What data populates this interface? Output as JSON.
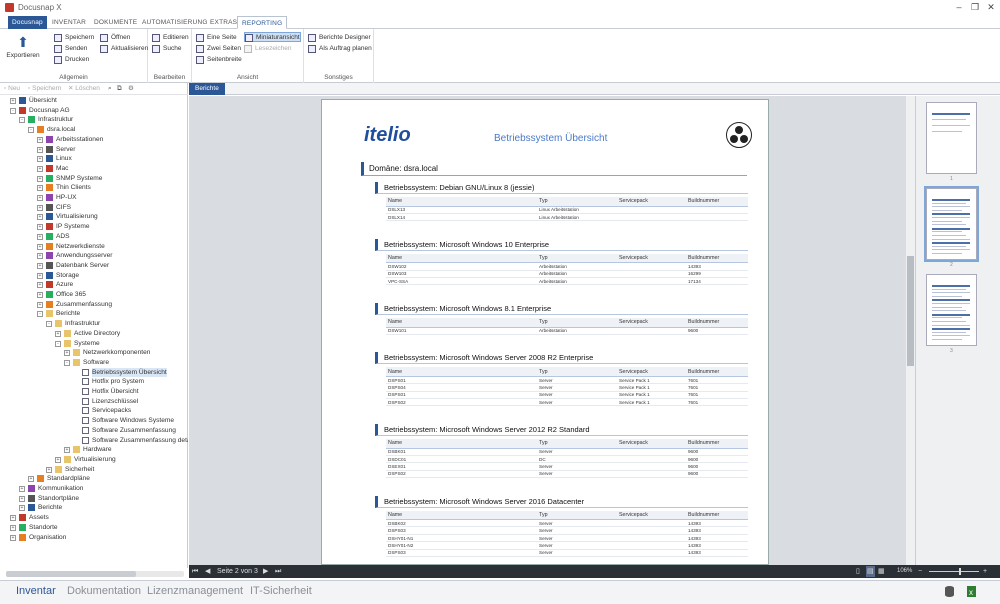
{
  "app": {
    "title": "Docusnap X"
  },
  "menu": {
    "file": "Docusnap",
    "tabs": [
      "INVENTAR",
      "DOKUMENTE",
      "AUTOMATISIERUNG",
      "EXTRAS",
      "REPORTING"
    ]
  },
  "ribbon": {
    "export_label": "Exportieren",
    "save": "Speichern",
    "open": "Öffnen",
    "send": "Senden",
    "refresh": "Aktualisieren",
    "print": "Drucken",
    "group_general": "Allgemein",
    "edit": "Editieren",
    "search": "Suche",
    "group_edit": "Bearbeiten",
    "one_page": "Eine Seite",
    "two_pages": "Zwei Seiten",
    "page_width": "Seitenbreite",
    "thumbnails": "Miniaturansicht",
    "bookmarks": "Lesezeichen",
    "group_view": "Ansicht",
    "report_designer": "Berichte Designer",
    "schedule": "Als Auftrag planen",
    "group_misc": "Sonstiges"
  },
  "left_toolbar": {
    "new": "Neu",
    "save": "Speichern",
    "delete": "Löschen"
  },
  "tree": [
    {
      "label": "Übersicht",
      "level": 0,
      "icon": "overview-icon",
      "expand": "+"
    },
    {
      "label": "Docusnap AG",
      "level": 0,
      "icon": "company-icon",
      "expand": "-"
    },
    {
      "label": "Infrastruktur",
      "level": 1,
      "icon": "infrastructure-icon",
      "expand": "-"
    },
    {
      "label": "dsra.local",
      "level": 2,
      "icon": "domain-icon",
      "expand": "-"
    },
    {
      "label": "Arbeitsstationen",
      "level": 3,
      "icon": "workstation-icon",
      "expand": "+"
    },
    {
      "label": "Server",
      "level": 3,
      "icon": "server-icon",
      "expand": "+"
    },
    {
      "label": "Linux",
      "level": 3,
      "icon": "linux-icon",
      "expand": "+"
    },
    {
      "label": "Mac",
      "level": 3,
      "icon": "mac-icon",
      "expand": "+"
    },
    {
      "label": "SNMP Systeme",
      "level": 3,
      "icon": "snmp-icon",
      "expand": "+"
    },
    {
      "label": "Thin Clients",
      "level": 3,
      "icon": "thin-client-icon",
      "expand": "+"
    },
    {
      "label": "HP-UX",
      "level": 3,
      "icon": "hpux-icon",
      "expand": "+"
    },
    {
      "label": "CIFS",
      "level": 3,
      "icon": "cifs-icon",
      "expand": "+"
    },
    {
      "label": "Virtualisierung",
      "level": 3,
      "icon": "virtualization-icon",
      "expand": "+"
    },
    {
      "label": "IP Systeme",
      "level": 3,
      "icon": "ip-system-icon",
      "expand": "+"
    },
    {
      "label": "ADS",
      "level": 3,
      "icon": "ads-icon",
      "expand": "+"
    },
    {
      "label": "Netzwerkdienste",
      "level": 3,
      "icon": "network-service-icon",
      "expand": "+"
    },
    {
      "label": "Anwendungsserver",
      "level": 3,
      "icon": "app-server-icon",
      "expand": "+"
    },
    {
      "label": "Datenbank Server",
      "level": 3,
      "icon": "database-icon",
      "expand": "+"
    },
    {
      "label": "Storage",
      "level": 3,
      "icon": "storage-icon",
      "expand": "+"
    },
    {
      "label": "Azure",
      "level": 3,
      "icon": "azure-icon",
      "expand": "+"
    },
    {
      "label": "Office 365",
      "level": 3,
      "icon": "office365-icon",
      "expand": "+"
    },
    {
      "label": "Zusammenfassung",
      "level": 3,
      "icon": "summary-icon",
      "expand": "+"
    },
    {
      "label": "Berichte",
      "level": 3,
      "icon": "reports-folder-icon",
      "expand": "-"
    },
    {
      "label": "Infrastruktur",
      "level": 4,
      "icon": "folder-icon",
      "expand": "-"
    },
    {
      "label": "Active Directory",
      "level": 5,
      "icon": "folder-icon",
      "expand": "+"
    },
    {
      "label": "Systeme",
      "level": 5,
      "icon": "folder-icon",
      "expand": "-"
    },
    {
      "label": "Netzwerkkomponenten",
      "level": 6,
      "icon": "folder-icon",
      "expand": "+"
    },
    {
      "label": "Software",
      "level": 6,
      "icon": "folder-icon",
      "expand": "-"
    },
    {
      "label": "Betriebssystem Übersicht",
      "level": 7,
      "icon": "report-icon",
      "expand": "",
      "selected": true
    },
    {
      "label": "Hotfix pro System",
      "level": 7,
      "icon": "report-icon",
      "expand": ""
    },
    {
      "label": "Hotfix Übersicht",
      "level": 7,
      "icon": "report-icon",
      "expand": ""
    },
    {
      "label": "Lizenzschlüssel",
      "level": 7,
      "icon": "report-icon",
      "expand": ""
    },
    {
      "label": "Servicepacks",
      "level": 7,
      "icon": "report-icon",
      "expand": ""
    },
    {
      "label": "Software Windows Systeme",
      "level": 7,
      "icon": "report-icon",
      "expand": ""
    },
    {
      "label": "Software Zusammenfassung",
      "level": 7,
      "icon": "report-icon",
      "expand": ""
    },
    {
      "label": "Software Zusammenfassung detaillie",
      "level": 7,
      "icon": "report-icon",
      "expand": ""
    },
    {
      "label": "Hardware",
      "level": 6,
      "icon": "folder-icon",
      "expand": "+"
    },
    {
      "label": "Virtualisierung",
      "level": 5,
      "icon": "folder-icon",
      "expand": "+"
    },
    {
      "label": "Sicherheit",
      "level": 4,
      "icon": "folder-icon",
      "expand": "+"
    },
    {
      "label": "Standardpläne",
      "level": 2,
      "icon": "plan-icon",
      "expand": "+"
    },
    {
      "label": "Kommunikation",
      "level": 1,
      "icon": "communication-icon",
      "expand": "+"
    },
    {
      "label": "Standortpläne",
      "level": 1,
      "icon": "location-plan-icon",
      "expand": "+"
    },
    {
      "label": "Berichte",
      "level": 1,
      "icon": "reports-icon",
      "expand": "+"
    },
    {
      "label": "Assets",
      "level": 0,
      "icon": "assets-icon",
      "expand": "+"
    },
    {
      "label": "Standorte",
      "level": 0,
      "icon": "location-icon",
      "expand": "+"
    },
    {
      "label": "Organisation",
      "level": 0,
      "icon": "organization-icon",
      "expand": "+"
    }
  ],
  "doc_tab": "Berichte",
  "report": {
    "logo": "itelio",
    "title": "Betriebssystem Übersicht",
    "domain": "Domäne: dsra.local",
    "columns": [
      "Name",
      "Typ",
      "Servicepack",
      "Buildnummer"
    ],
    "sections": [
      {
        "title": "Betriebssystem: Debian GNU/Linux 8 (jessie)",
        "rows": [
          [
            "DSLX13",
            "Linux Arbeitsstation",
            "",
            ""
          ],
          [
            "DSLX14",
            "Linux Arbeitsstation",
            "",
            ""
          ]
        ]
      },
      {
        "title": "Betriebssystem: Microsoft Windows 10 Enterprise",
        "rows": [
          [
            "DSW102",
            "Arbeitsstation",
            "",
            "14393"
          ],
          [
            "DSW103",
            "Arbeitsstation",
            "",
            "16299"
          ],
          [
            "VPC-SSA",
            "Arbeitsstation",
            "",
            "17134"
          ]
        ]
      },
      {
        "title": "Betriebssystem: Microsoft Windows 8.1 Enterprise",
        "rows": [
          [
            "DSW101",
            "Arbeitsstation",
            "",
            "9600"
          ]
        ]
      },
      {
        "title": "Betriebssystem: Microsoft Windows Server 2008 R2 Enterprise",
        "rows": [
          [
            "DSPS01",
            "Server",
            "Service Pack 1",
            "7601"
          ],
          [
            "DSPS04",
            "Server",
            "Service Pack 1",
            "7601"
          ],
          [
            "DSPS01",
            "Server",
            "Service Pack 1",
            "7601"
          ],
          [
            "DSPS02",
            "Server",
            "Service Pack 1",
            "7601"
          ]
        ]
      },
      {
        "title": "Betriebssystem: Microsoft Windows Server 2012 R2 Standard",
        "rows": [
          [
            "DSBK01",
            "Server",
            "",
            "9600"
          ],
          [
            "DSDC01",
            "DC",
            "",
            "9600"
          ],
          [
            "DSEX01",
            "Server",
            "",
            "9600"
          ],
          [
            "DSPS02",
            "Server",
            "",
            "9600"
          ]
        ]
      },
      {
        "title": "Betriebssystem: Microsoft Windows Server 2016 Datacenter",
        "rows": [
          [
            "DSBK02",
            "Server",
            "",
            "14393"
          ],
          [
            "DSPS03",
            "Server",
            "",
            "14393"
          ],
          [
            "DSHY01-N1",
            "Server",
            "",
            "14393"
          ],
          [
            "DSHY01-N2",
            "Server",
            "",
            "14393"
          ],
          [
            "DSPS03",
            "Server",
            "",
            "14393"
          ]
        ]
      }
    ]
  },
  "pager": {
    "text": "Seite 2 von 3",
    "zoom": "106%"
  },
  "thumb_numbers": [
    "1",
    "2",
    "3"
  ],
  "status_tabs": [
    "Inventar",
    "Dokumentation",
    "Lizenzmanagement",
    "IT-Sicherheit"
  ],
  "colors": {
    "accent": "#2b5797"
  }
}
